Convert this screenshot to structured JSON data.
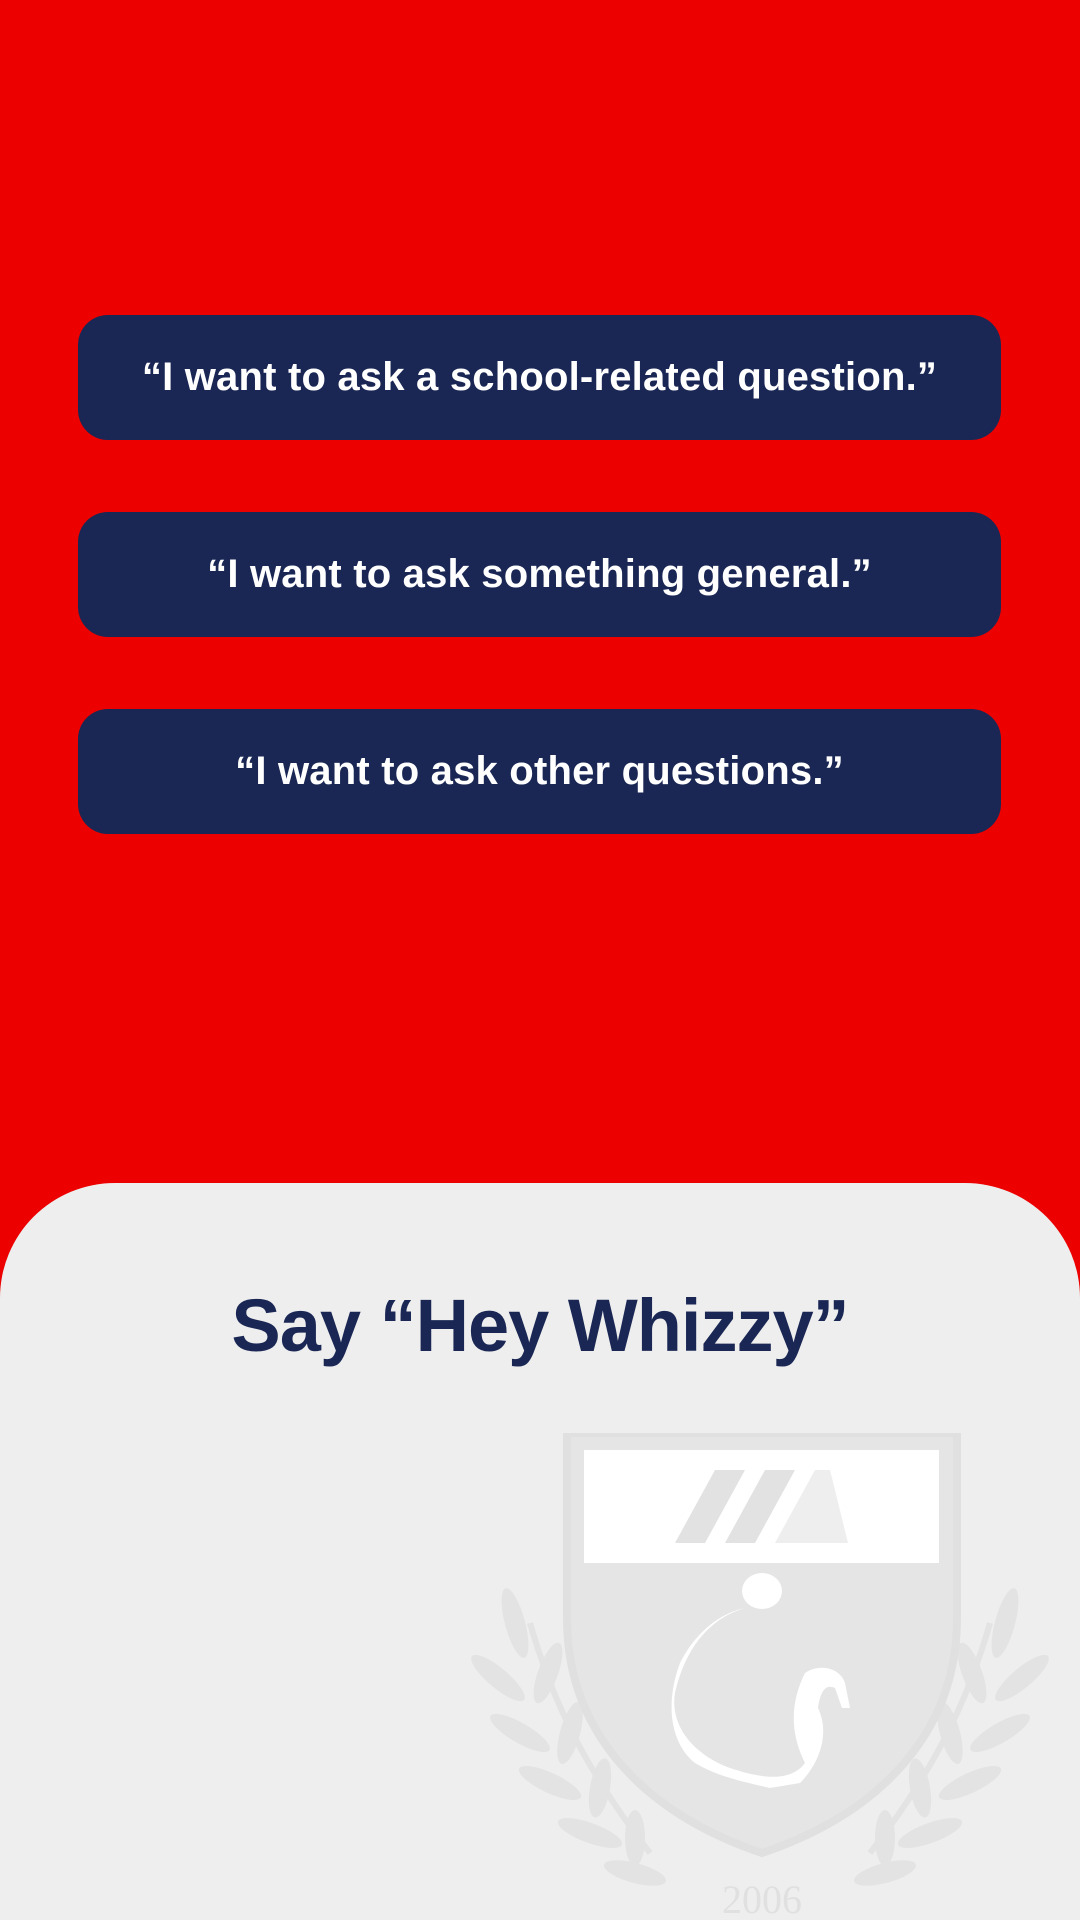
{
  "options": [
    {
      "label": "“I want to ask a school-related question.”"
    },
    {
      "label": "“I want to ask something general.”"
    },
    {
      "label": "“I want to ask other questions.”"
    }
  ],
  "wake": {
    "title": "Say “Hey Whizzy”"
  },
  "crest": {
    "year": "2006",
    "icon": "school-crest-watermark"
  },
  "colors": {
    "background": "#EC0000",
    "button": "#1A2754",
    "panel": "#EEEEEE",
    "title": "#1A2754"
  }
}
